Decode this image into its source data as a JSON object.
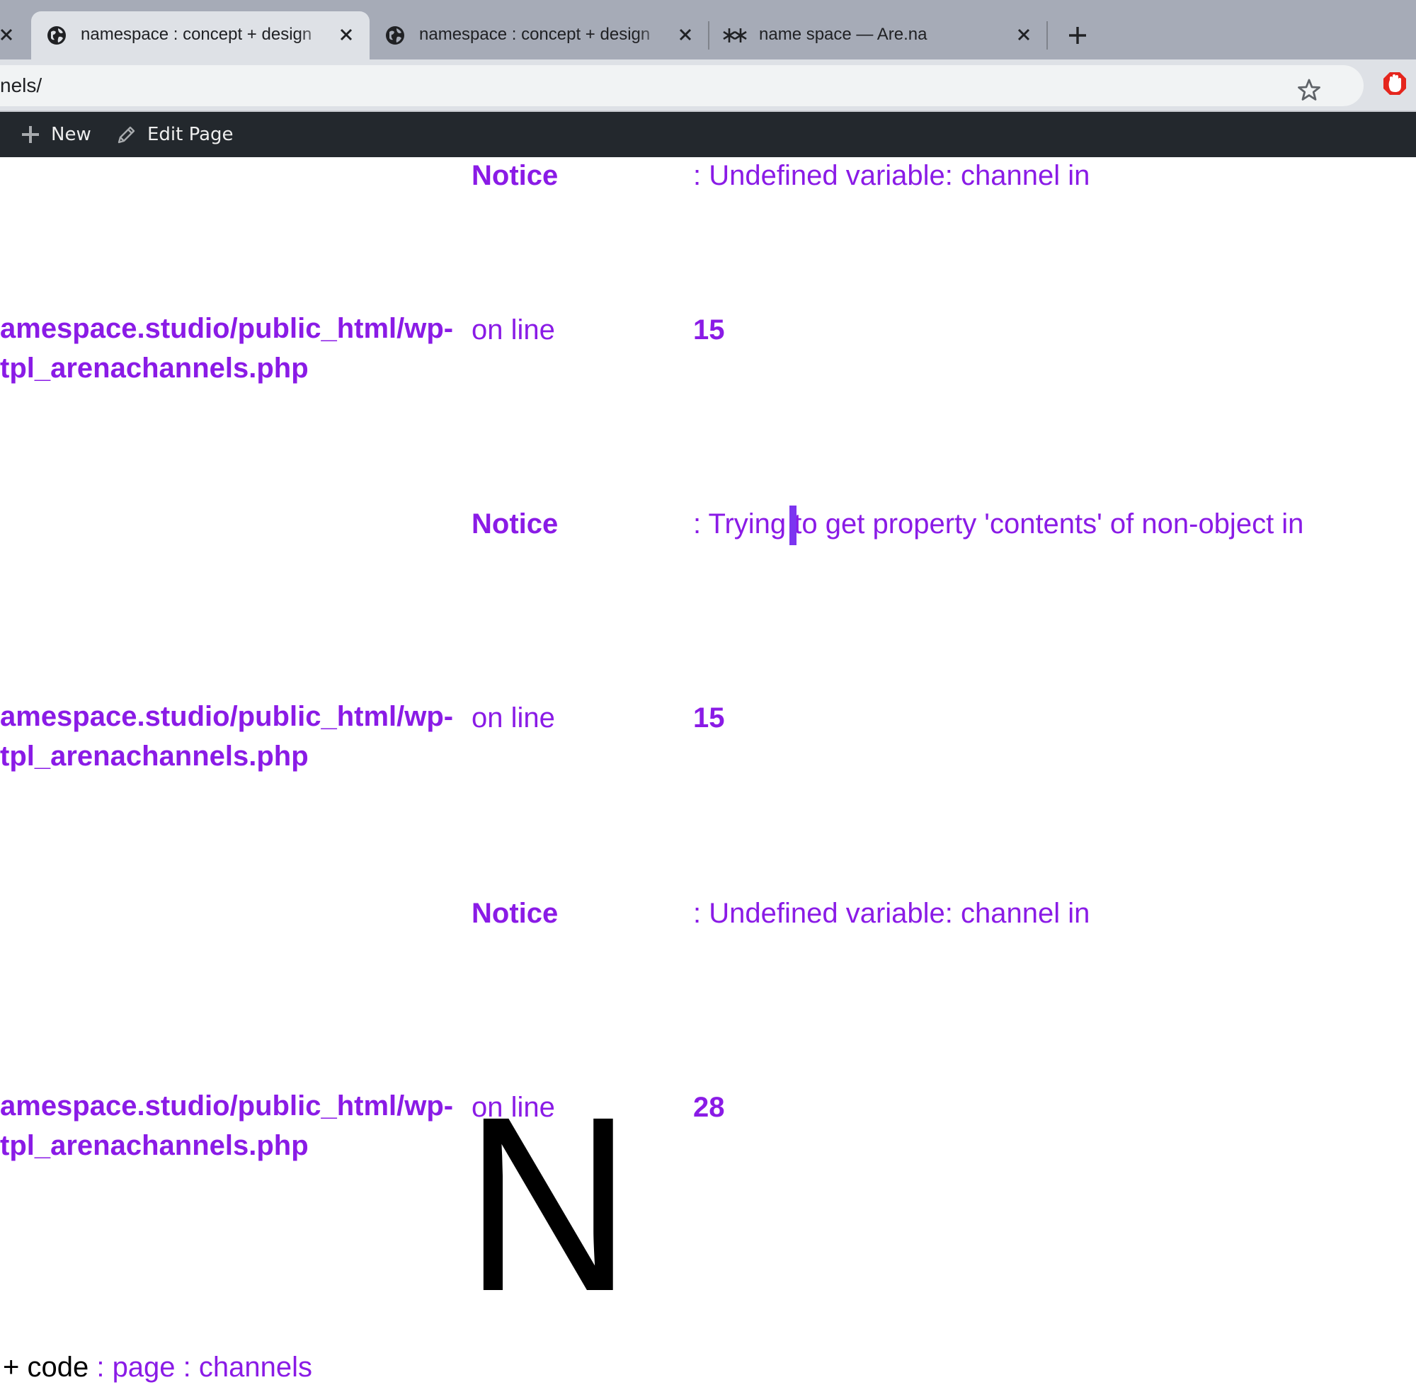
{
  "browser": {
    "tabs": [
      {
        "title": "namespace : concept + design",
        "active": true,
        "favicon": "globe-icon"
      },
      {
        "title": "namespace : concept + design",
        "active": false,
        "favicon": "globe-icon"
      },
      {
        "title": "name space — Are.na",
        "active": false,
        "favicon": "arena-asterisks-icon"
      }
    ],
    "address": "nels/"
  },
  "admin_bar": {
    "new_label": "New",
    "edit_label": "Edit Page"
  },
  "notices": [
    {
      "label": "Notice",
      "message": ": Undefined variable: channel in",
      "path_line1": "amespace.studio/public_html/wp-",
      "path_line2": "tpl_arenachannels.php",
      "on_line": "on line",
      "line_number": "15"
    },
    {
      "label": "Notice",
      "message": ": Trying to get property 'contents' of non-object in",
      "path_line1": "amespace.studio/public_html/wp-",
      "path_line2": "tpl_arenachannels.php",
      "on_line": "on line",
      "line_number": "15"
    },
    {
      "label": "Notice",
      "message": ": Undefined variable: channel in",
      "path_line1": "amespace.studio/public_html/wp-",
      "path_line2": "tpl_arenachannels.php",
      "on_line": "on line",
      "line_number": "28"
    }
  ],
  "logo": {
    "letter": "N"
  },
  "breadcrumb": {
    "prefix": "+ code",
    "sep1": " : ",
    "page": "page",
    "sep2": " : ",
    "current": "channels"
  },
  "colors": {
    "notice_purple": "#8a1be6",
    "admin_bar": "#23282d",
    "tabstrip": "#a6abb7"
  }
}
